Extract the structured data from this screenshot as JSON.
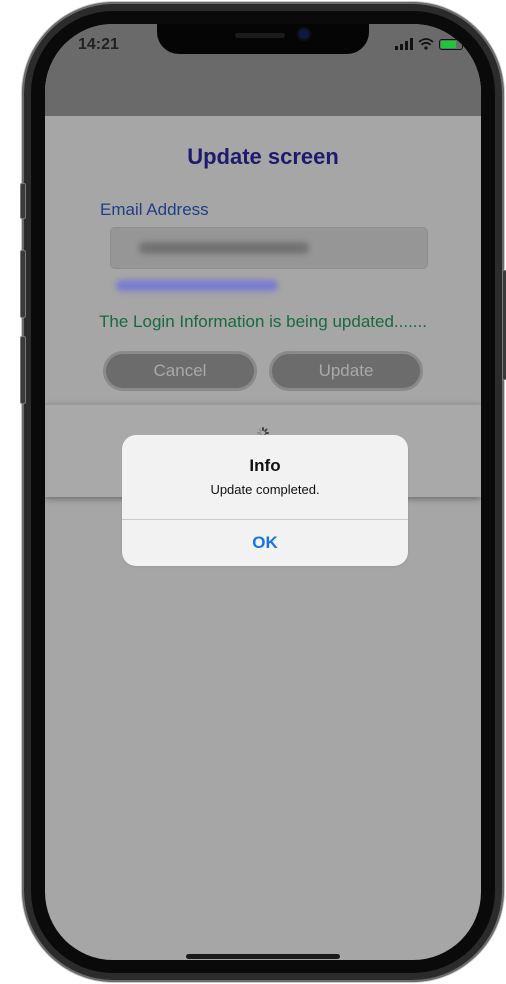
{
  "status_bar": {
    "time": "14:21"
  },
  "page": {
    "title": "Update screen",
    "email_label": "Email Address",
    "status_message": "The Login Information is being updated.......",
    "cancel_label": "Cancel",
    "update_label": "Update"
  },
  "alert": {
    "title": "Info",
    "message": "Update completed.",
    "ok_label": "OK"
  },
  "colors": {
    "title": "#1e1a6e",
    "label": "#1f3e8a",
    "status_message": "#19693f",
    "alert_button": "#1575e8",
    "overlay": "#a6a6a6",
    "battery": "#19c93b"
  },
  "icons": [
    "signal-icon",
    "wifi-icon",
    "battery-icon",
    "spinner-icon"
  ]
}
